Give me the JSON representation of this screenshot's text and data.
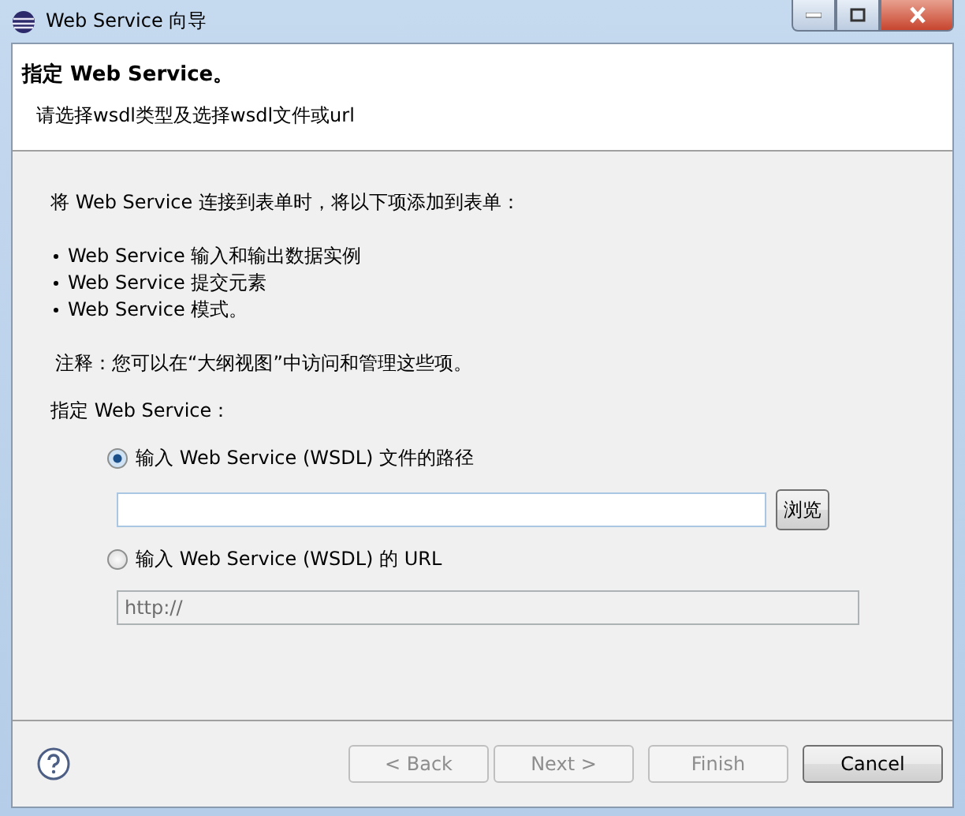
{
  "window": {
    "title": "Web Service 向导"
  },
  "header": {
    "title": "指定 Web Service。",
    "subtitle": "请选择wsdl类型及选择wsdl文件或url"
  },
  "intro": "将 Web Service 连接到表单时，将以下项添加到表单：",
  "bullets": [
    "Web Service 输入和输出数据实例",
    "Web Service 提交元素",
    "Web Service 模式。"
  ],
  "note": "注释：您可以在“大纲视图”中访问和管理这些项。",
  "section_label": "指定 Web Service：",
  "options": [
    {
      "label": "输入 Web Service (WSDL) 文件的路径",
      "selected": true,
      "field": {
        "disabled": false
      },
      "browse_button": "浏览"
    },
    {
      "label": "输入 Web Service (WSDL) 的 URL",
      "selected": false,
      "field": {
        "value": "http://",
        "disabled": true
      }
    }
  ],
  "buttons": [
    {
      "label": "< Back",
      "disabled": true
    },
    {
      "label": "Next >",
      "disabled": true
    },
    {
      "label": "Finish",
      "disabled": true
    },
    {
      "label": "Cancel",
      "disabled": false
    }
  ]
}
